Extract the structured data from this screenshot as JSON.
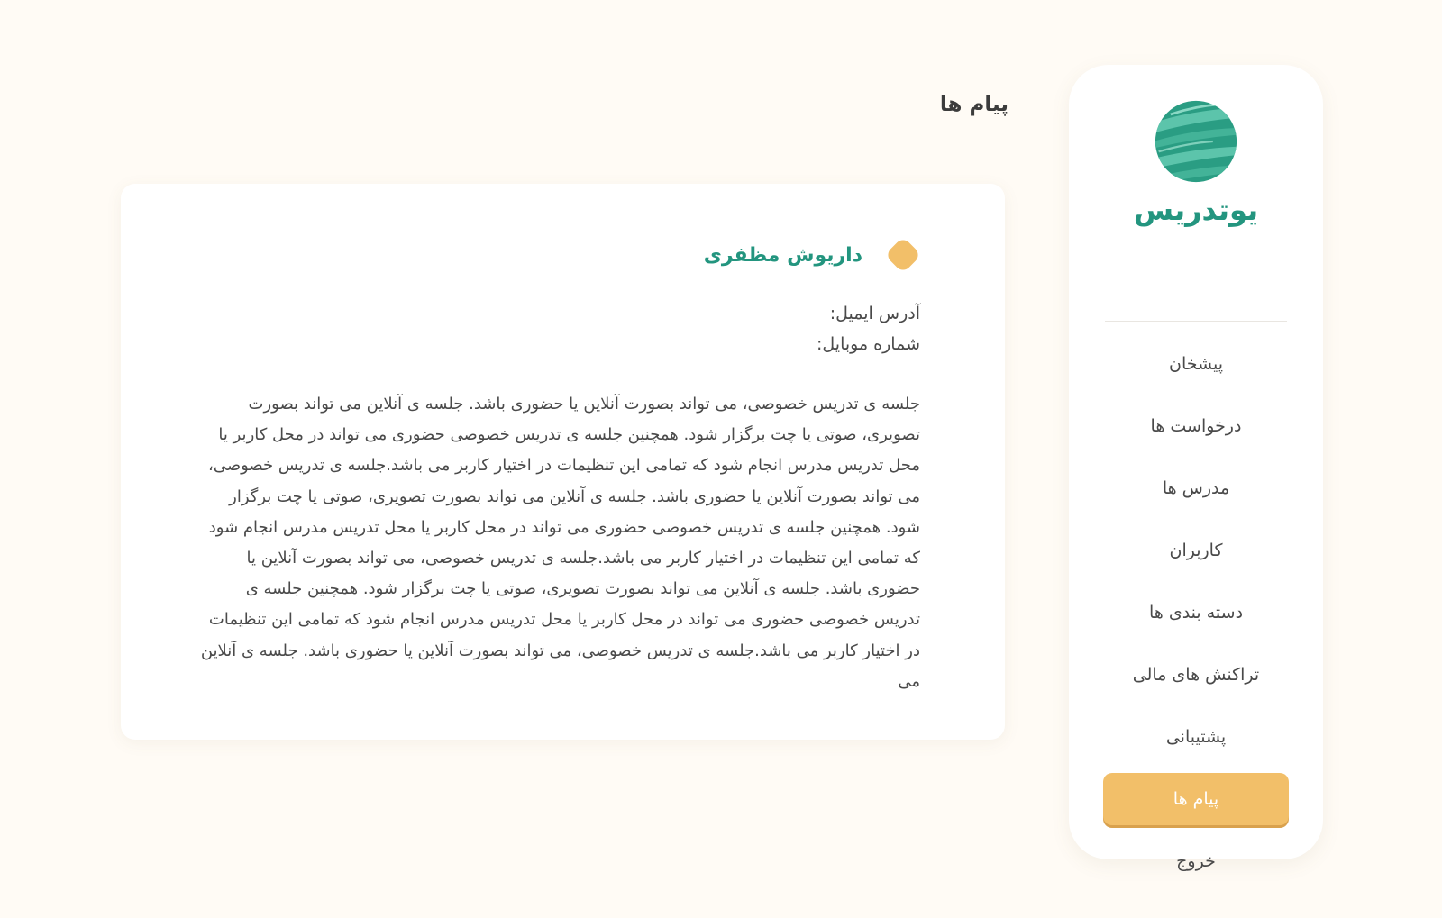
{
  "sidebar": {
    "brand": "یوتدریس",
    "items": [
      {
        "label": "پیشخان",
        "active": false
      },
      {
        "label": "درخواست ها",
        "active": false
      },
      {
        "label": "مدرس ها",
        "active": false
      },
      {
        "label": "کاربران",
        "active": false
      },
      {
        "label": "دسته بندی ها",
        "active": false
      },
      {
        "label": "تراکنش های مالی",
        "active": false
      },
      {
        "label": "پشتیبانی",
        "active": false
      },
      {
        "label": "پیام ها",
        "active": true
      },
      {
        "label": "خروج",
        "active": false
      }
    ]
  },
  "page": {
    "title": "پیام ها"
  },
  "message": {
    "sender_name": "داریوش مظفری",
    "email_label": "آدرس ایمیل:",
    "mobile_label": "شماره موبایل:",
    "body": "جلسه ی تدریس خصوصی، می تواند بصورت آنلاین یا حضوری باشد. جلسه ی آنلاین می تواند بصورت تصویری، صوتی یا چت برگزار شود. همچنین جلسه ی تدریس خصوصی حضوری می تواند در محل کاربر یا محل تدریس مدرس انجام شود که تمامی این تنظیمات در اختیار کاربر می باشد.جلسه ی تدریس خصوصی، می تواند بصورت آنلاین یا حضوری باشد. جلسه ی آنلاین می تواند بصورت تصویری، صوتی یا چت برگزار شود. همچنین جلسه ی تدریس خصوصی حضوری می تواند در محل کاربر یا محل تدریس مدرس انجام شود که تمامی این تنظیمات در اختیار کاربر می باشد.جلسه ی تدریس خصوصی، می تواند بصورت آنلاین یا حضوری باشد. جلسه ی آنلاین می تواند بصورت تصویری، صوتی یا چت برگزار شود. همچنین جلسه ی تدریس خصوصی حضوری می تواند در محل کاربر یا محل تدریس مدرس انجام شود که تمامی این تنظیمات در اختیار کاربر می باشد.جلسه ی تدریس خصوصی، می تواند بصورت آنلاین یا حضوری باشد. جلسه ی آنلاین می"
  },
  "colors": {
    "background": "#fffbf5",
    "brand_green": "#23957f",
    "accent_yellow": "#f2bf69",
    "card": "#ffffff"
  },
  "icons": {
    "logo": "planet-logo-icon",
    "sender": "sender-dot-icon"
  }
}
